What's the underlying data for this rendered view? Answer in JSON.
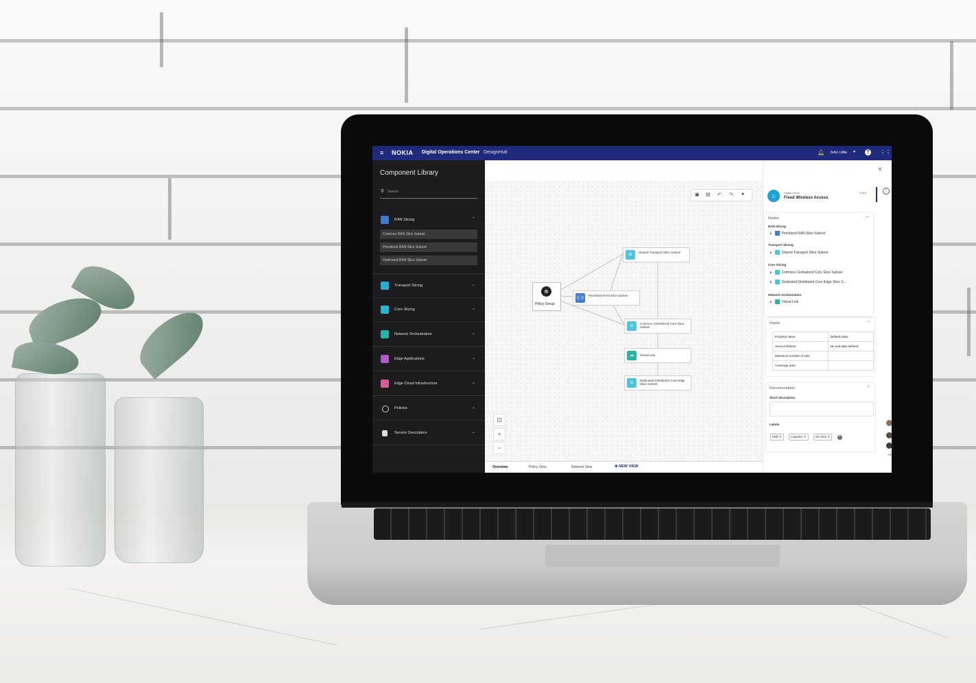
{
  "app": {
    "brand": "NOKIA",
    "title": "Digital Operations Center",
    "subtitle": "DesignHub",
    "user_name": "John Little",
    "help_label": "?"
  },
  "sidebar": {
    "heading": "Component Library",
    "search_placeholder": "Search",
    "sections": [
      {
        "label": "RAN Slicing",
        "color": "#3f7bd1",
        "expanded": true,
        "items": [
          "Common RAN Slice Subnet",
          "Prioritized RAN Slice Subnet",
          "Dedicated RAN Slice Subnet"
        ]
      },
      {
        "label": "Transport Slicing",
        "color": "#29a9d6"
      },
      {
        "label": "Core Slicing",
        "color": "#29b6d1"
      },
      {
        "label": "Network Orchestration",
        "color": "#2bb3a3"
      },
      {
        "label": "Edge Applications",
        "color": "#b05bc9"
      },
      {
        "label": "Edge Cloud Infrastructure",
        "color": "#d65b9a"
      },
      {
        "label": "Policies",
        "color": "#1c1c1e"
      },
      {
        "label": "Service Descriptors",
        "color": "#1c1c1e"
      }
    ]
  },
  "canvas": {
    "policy_group_label": "Policy Group",
    "nodes": [
      {
        "label": "Shared Transport Slice Subnet"
      },
      {
        "label": "Prioritized RAN Slice Subnet"
      },
      {
        "label": "Common Centralized Core Slice Subnet"
      },
      {
        "label": "Virtual Link"
      },
      {
        "label": "Dedicated Distributed Core Edge Slice Subnet"
      }
    ]
  },
  "view_tabs": {
    "tabs": [
      "Overview",
      "Policy View",
      "Network View"
    ],
    "active": "Overview",
    "new_view_label": "NEW VIEW"
  },
  "panel": {
    "eyebrow": "Digital Home",
    "title": "Fixed Wireless Access",
    "version": "1.0.0",
    "nodes_header": "Nodes",
    "node_groups": [
      {
        "name": "RAN Slicing",
        "items": [
          "Prioritized RAN Slice Subnet"
        ]
      },
      {
        "name": "Transport Slicing",
        "items": [
          "Shared Transport Slice Subnet"
        ]
      },
      {
        "name": "Core Slicing",
        "items": [
          "Common Centralized Core Slice Subnet",
          "Dedicated Distributed Core Edge Slice S..."
        ]
      },
      {
        "name": "Network Orchestration",
        "items": [
          "Virtual Link"
        ]
      }
    ],
    "inputs_header": "Inputs",
    "inputs_columns": [
      "Property name",
      "Default value"
    ],
    "inputs_rows": [
      [
        "Service lifetime",
        "No end date defined"
      ],
      [
        "Maximum number of UEs",
        ""
      ],
      [
        "Coverage area",
        ""
      ]
    ],
    "documentation_header": "Documentation",
    "short_description_label": "Short description",
    "labels_label": "Labels",
    "labels": [
      "B2B",
      "Logistics",
      "5G slice"
    ],
    "collaborators_more": "+2"
  }
}
